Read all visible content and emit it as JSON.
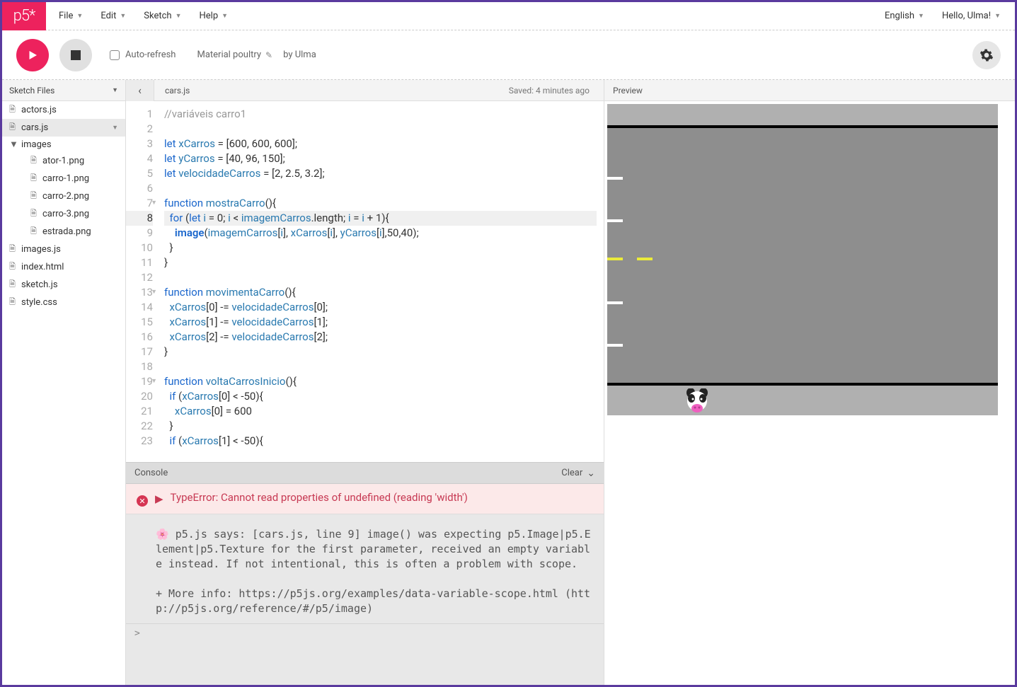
{
  "logo": "p5*",
  "menus": [
    "File",
    "Edit",
    "Sketch",
    "Help"
  ],
  "topright": {
    "lang": "English",
    "greeting": "Hello, Ulma!"
  },
  "toolbar": {
    "autorefresh_label": "Auto-refresh",
    "sketch_name": "Material poultry",
    "byline": "by Ulma"
  },
  "sidebar": {
    "header": "Sketch Files",
    "files": [
      {
        "name": "actors.js",
        "depth": 0,
        "type": "file"
      },
      {
        "name": "cars.js",
        "depth": 0,
        "type": "file",
        "selected": true
      },
      {
        "name": "images",
        "depth": 0,
        "type": "folder"
      },
      {
        "name": "ator-1.png",
        "depth": 1,
        "type": "file"
      },
      {
        "name": "carro-1.png",
        "depth": 1,
        "type": "file"
      },
      {
        "name": "carro-2.png",
        "depth": 1,
        "type": "file"
      },
      {
        "name": "carro-3.png",
        "depth": 1,
        "type": "file"
      },
      {
        "name": "estrada.png",
        "depth": 1,
        "type": "file"
      },
      {
        "name": "images.js",
        "depth": 0,
        "type": "file"
      },
      {
        "name": "index.html",
        "depth": 0,
        "type": "file"
      },
      {
        "name": "sketch.js",
        "depth": 0,
        "type": "file"
      },
      {
        "name": "style.css",
        "depth": 0,
        "type": "file"
      }
    ]
  },
  "editor": {
    "current_file": "cars.js",
    "saved_text": "Saved: 4 minutes ago",
    "highlighted_line": 8,
    "fold_lines": [
      7,
      13,
      19
    ],
    "lines": [
      "//variáveis carro1",
      "",
      "let xCarros = [600, 600, 600];",
      "let yCarros = [40, 96, 150];",
      "let velocidadeCarros = [2, 2.5, 3.2];",
      "",
      "function mostraCarro(){",
      "  for (let i = 0; i < imagemCarros.length; i = i + 1){",
      "    image(imagemCarros[i], xCarros[i], yCarros[i],50,40);",
      "  }",
      "}",
      "",
      "function movimentaCarro(){",
      "  xCarros[0] -= velocidadeCarros[0];",
      "  xCarros[1] -= velocidadeCarros[1];",
      "  xCarros[2] -= velocidadeCarros[2];",
      "}",
      "",
      "function voltaCarrosInicio(){",
      "  if (xCarros[0] < -50){",
      "    xCarros[0] = 600",
      "  }",
      "  if (xCarros[1] < -50){"
    ]
  },
  "console": {
    "title": "Console",
    "clear_label": "Clear",
    "error": "TypeError: Cannot read properties of undefined (reading 'width')",
    "message": "🌸 p5.js says: [cars.js, line 9] image() was expecting p5.Image|p5.Element|p5.Texture for the first parameter, received an empty variable instead. If not intentional, this is often a problem with scope.\n\n+ More info: https://p5js.org/examples/data-variable-scope.html (http://p5js.org/reference/#/p5/image)",
    "prompt": ">"
  },
  "preview": {
    "title": "Preview"
  }
}
